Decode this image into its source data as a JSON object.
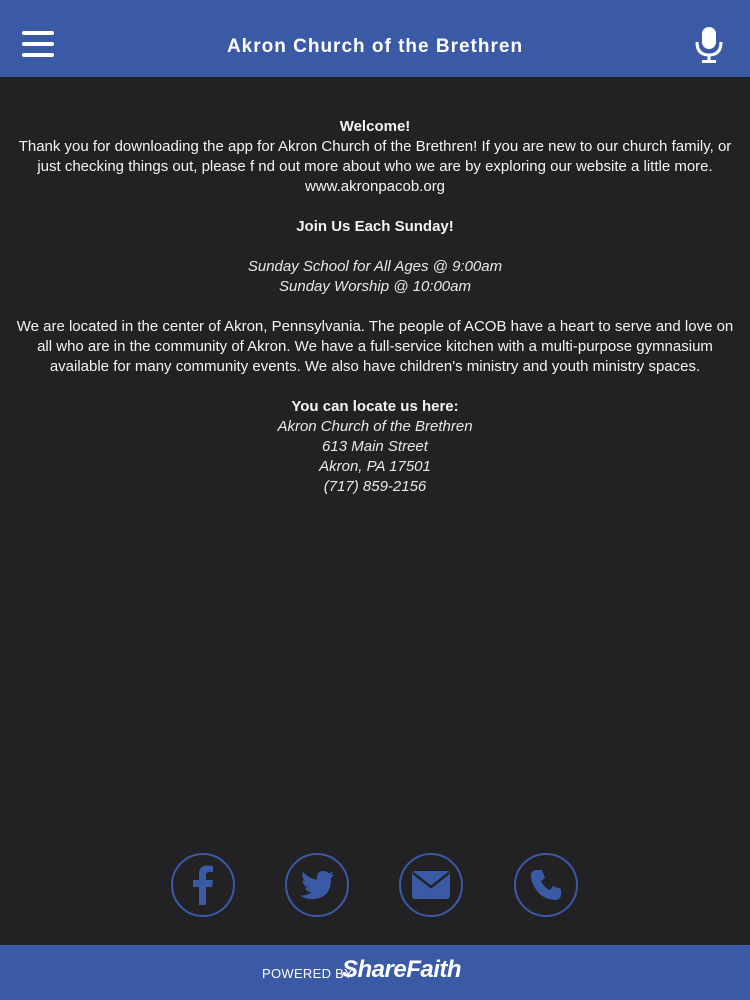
{
  "header": {
    "title": "Akron Church of the Brethren",
    "menu_icon": "hamburger-menu-icon",
    "mic_icon": "microphone-icon"
  },
  "content": {
    "welcome_heading": "Welcome!",
    "welcome_text": "Thank you for downloading the app for Akron Church of the Brethren!  If you are new to our church family, or just checking things out, please f nd out more about who we are by exploring our website a little more.",
    "website": "www.akronpacob.org",
    "sunday_heading": "Join Us Each Sunday!",
    "sunday_school": "Sunday School for All Ages @ 9:00am",
    "sunday_worship": "Sunday Worship @ 10:00am",
    "about_text": "We are located in the center of Akron, Pennsylvania.  The people of ACOB have a heart to serve and love on all who are in the community of Akron.  We have a full-service kitchen with a multi-purpose gymnasium available for many community events.  We also have children's ministry and youth ministry spaces.",
    "locate_heading": "You can locate us here:",
    "address_name": "Akron Church of the Brethren",
    "address_street": "613 Main Street",
    "address_city": "Akron, PA 17501",
    "address_phone": "(717) 859-2156"
  },
  "social": {
    "icons": [
      "facebook-icon",
      "twitter-icon",
      "email-icon",
      "phone-icon"
    ]
  },
  "footer": {
    "powered_by": "POWERED BY",
    "brand": "ShareFaith"
  },
  "colors": {
    "accent": "#3a5aa6",
    "background": "#222224",
    "text": "#ffffff"
  }
}
